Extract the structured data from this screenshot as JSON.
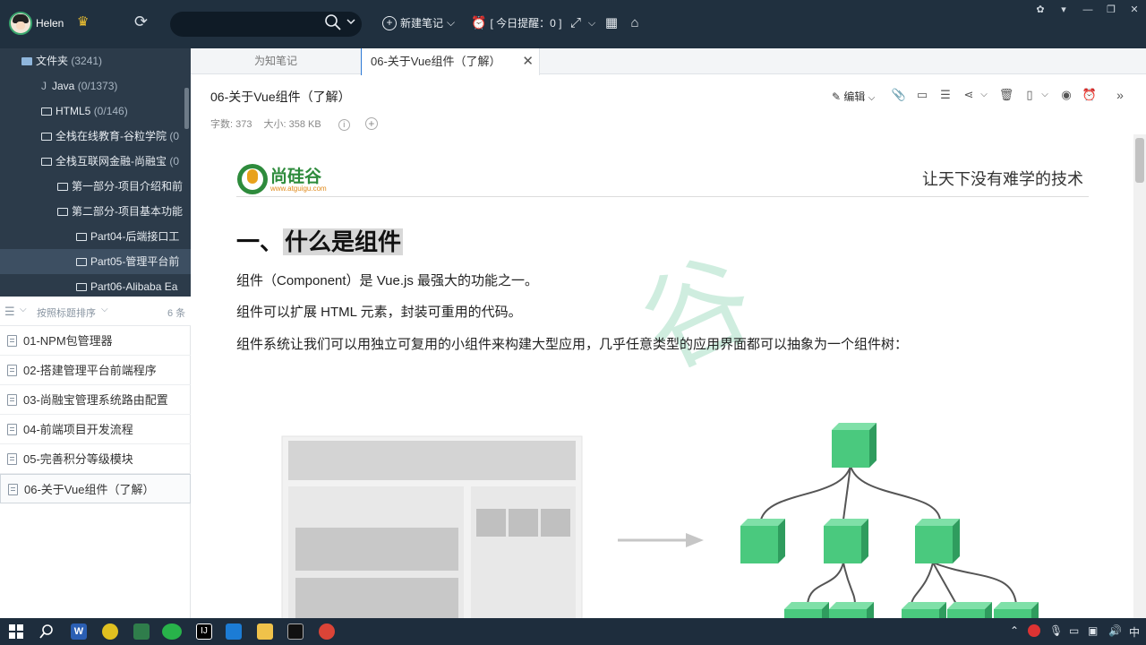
{
  "topbar": {
    "username": "Helen",
    "search_placeholder": "",
    "new_note_label": "新建笔记",
    "reminder_label": "[ 今日提醒：0 ]"
  },
  "folders": {
    "root": {
      "label": "文件夹",
      "count": "(3241)"
    },
    "items": [
      {
        "label": "Java",
        "count": "(0/1373)"
      },
      {
        "label": "HTML5",
        "count": "(0/146)"
      },
      {
        "label": "全栈在线教育-谷粒学院",
        "count": "(0"
      },
      {
        "label": "全栈互联网金融-尚融宝",
        "count": "(0"
      },
      {
        "label": "第一部分-项目介绍和前",
        "count": ""
      },
      {
        "label": "第二部分-项目基本功能",
        "count": ""
      },
      {
        "label": "Part04-后端接口工",
        "count": ""
      },
      {
        "label": "Part05-管理平台前",
        "count": ""
      },
      {
        "label": "Part06-Alibaba Ea",
        "count": ""
      }
    ]
  },
  "sortbar": {
    "label": "按照标题排序",
    "count": "6 条"
  },
  "notes": [
    "01-NPM包管理器",
    "02-搭建管理平台前端程序",
    "03-尚融宝管理系统路由配置",
    "04-前端项目开发流程",
    "05-完善积分等级模块",
    "06-关于Vue组件（了解）"
  ],
  "tabs": [
    "为知笔记",
    "06-关于Vue组件（了解）"
  ],
  "note": {
    "title": "06-关于Vue组件（了解）",
    "edit_label": "编辑",
    "word_count": "字数: 373",
    "size": "大小: 358 KB"
  },
  "doc": {
    "logo_text": "尚硅谷",
    "logo_url": "www.atguigu.com",
    "slogan": "让天下没有难学的技术",
    "heading_prefix": "一、",
    "heading_highlight": "什么是组件",
    "paragraphs": [
      "组件（Component）是 Vue.js 最强大的功能之一。",
      "组件可以扩展 HTML 元素，封装可重用的代码。",
      "组件系统让我们可以用独立可复用的小组件来构建大型应用，几乎任意类型的应用界面都可以抽象为一个组件树："
    ]
  },
  "taskbar": {
    "ime": "中"
  },
  "colors": {
    "topbar": "#20303f",
    "sidebar": "#2c3b4a",
    "accent": "#2d7ad6",
    "vue_green": "#42b983"
  }
}
